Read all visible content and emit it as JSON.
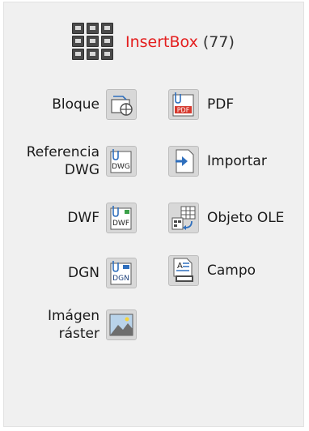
{
  "header": {
    "title_name": "InsertBox",
    "title_count": "(77)"
  },
  "items": {
    "bloque": {
      "label": "Bloque",
      "icon": "block-icon"
    },
    "referencia": {
      "label_line1": "Referencia",
      "label_line2": "DWG",
      "icon": "dwg-reference-icon",
      "badge": "DWG"
    },
    "dwf": {
      "label": "DWF",
      "icon": "dwf-icon",
      "badge": "DWF"
    },
    "dgn": {
      "label": "DGN",
      "icon": "dgn-icon",
      "badge": "DGN"
    },
    "imagen": {
      "label_line1": "Imágen",
      "label_line2": "ráster",
      "icon": "raster-image-icon"
    },
    "pdf": {
      "label": "PDF",
      "icon": "pdf-icon",
      "badge": "PDF"
    },
    "importar": {
      "label": "Importar",
      "icon": "import-icon"
    },
    "ole": {
      "label": "Objeto OLE",
      "icon": "ole-object-icon"
    },
    "campo": {
      "label": "Campo",
      "icon": "field-icon"
    }
  },
  "colors": {
    "title_accent": "#e41e1e",
    "panel_bg": "#f0f0f0"
  }
}
